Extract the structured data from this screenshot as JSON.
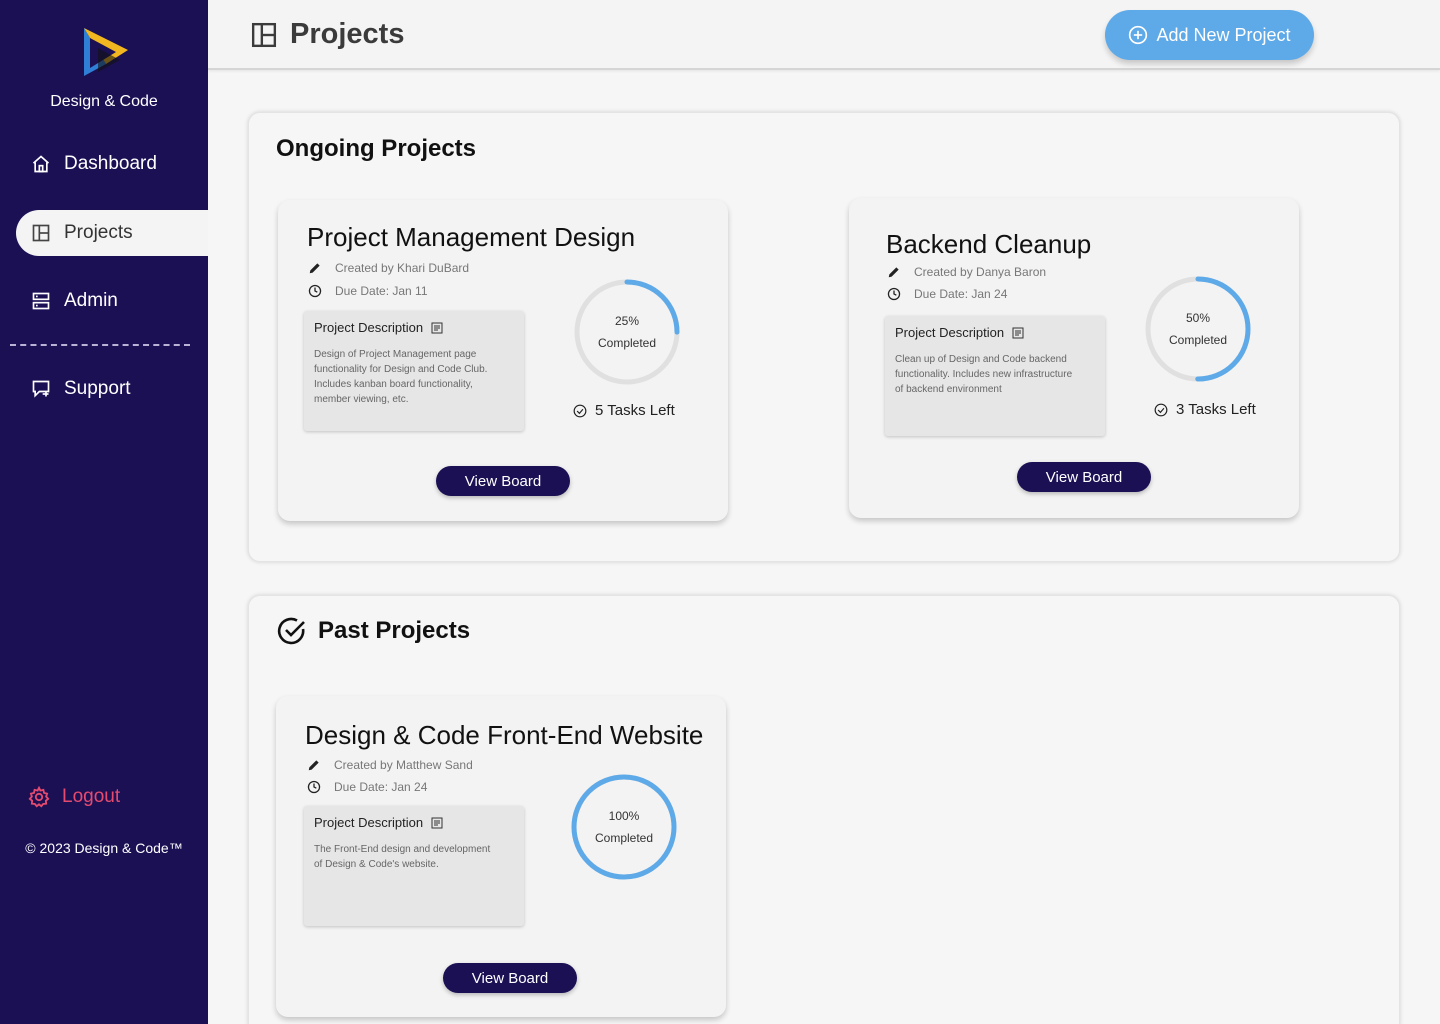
{
  "sidebar": {
    "brand": "Design & Code",
    "nav": [
      {
        "label": "Dashboard",
        "icon": "home-icon"
      },
      {
        "label": "Projects",
        "icon": "layout-icon"
      },
      {
        "label": "Admin",
        "icon": "server-icon"
      },
      {
        "label": "Support",
        "icon": "chat-icon"
      }
    ],
    "logout_label": "Logout",
    "copyright": "© 2023 Design & Code™"
  },
  "header": {
    "title": "Projects",
    "add_button_label": "Add New Project"
  },
  "ongoing": {
    "title": "Ongoing Projects",
    "projects": [
      {
        "title": "Project Management Design",
        "created_by": "Created by Khari DuBard",
        "due_date": "Due Date: Jan 11",
        "description_label": "Project Description",
        "description": "Design of Project Management page functionality for Design and Code Club. Includes kanban board functionality, member viewing, etc.",
        "percent": "25%",
        "progress": 0.25,
        "completed_label": "Completed",
        "tasks_left": "5 Tasks Left",
        "button_label": "View Board"
      },
      {
        "title": "Backend Cleanup",
        "created_by": "Created by Danya Baron",
        "due_date": "Due Date: Jan 24",
        "description_label": "Project Description",
        "description": "Clean up of Design and Code backend functionality. Includes new infrastructure of backend environment",
        "percent": "50%",
        "progress": 0.5,
        "completed_label": "Completed",
        "tasks_left": "3 Tasks Left",
        "button_label": "View Board"
      }
    ]
  },
  "past": {
    "title": "Past Projects",
    "projects": [
      {
        "title": "Design & Code Front-End Website",
        "created_by": "Created by Matthew Sand",
        "due_date": "Due Date: Jan 24",
        "description_label": "Project Description",
        "description": "The Front-End design and development of Design & Code's website.",
        "percent": "100%",
        "progress": 1.0,
        "completed_label": "Completed",
        "button_label": "View Board"
      }
    ]
  },
  "colors": {
    "sidebar_bg": "#1c1055",
    "accent_blue": "#5ea9e8",
    "logout_red": "#e54b6f",
    "button_dark": "#1c1055"
  }
}
